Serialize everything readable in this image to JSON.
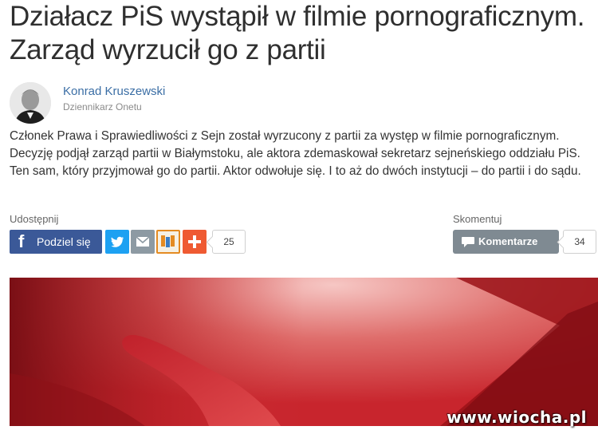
{
  "article": {
    "title": "Działacz PiS wystąpił w filmie pornograficznym. Zarząd wyrzucił go z partii",
    "author": {
      "name": "Konrad Kruszewski",
      "role": "Dziennikarz Onetu"
    },
    "lead": "Członek Prawa i Sprawiedliwości z Sejn został wyrzucony z partii za występ w filmie pornograficznym. Decyzję podjął zarząd partii w Białymstoku, ale aktora zdemaskował sekretarz sejneńskiego oddziału PiS. Ten sam, który przyjmował go do partii. Aktor odwołuje się. I to aż do dwóch instytucji – do partii i do sądu."
  },
  "share": {
    "label": "Udostępnij",
    "facebook_label": "Podziel się",
    "count": "25",
    "icons": [
      "facebook-icon",
      "twitter-icon",
      "mail-icon",
      "wykop-icon",
      "plus-icon"
    ]
  },
  "comments": {
    "label": "Skomentuj",
    "button_label": "Komentarze",
    "count": "34"
  },
  "watermark": "www.wiocha.pl",
  "colors": {
    "facebook": "#3b5998",
    "twitter": "#1da1f2",
    "mail": "#8d9aa3",
    "plus": "#ef5a32",
    "comment_button": "#7f8a92",
    "author_link": "#3b6ea5"
  }
}
